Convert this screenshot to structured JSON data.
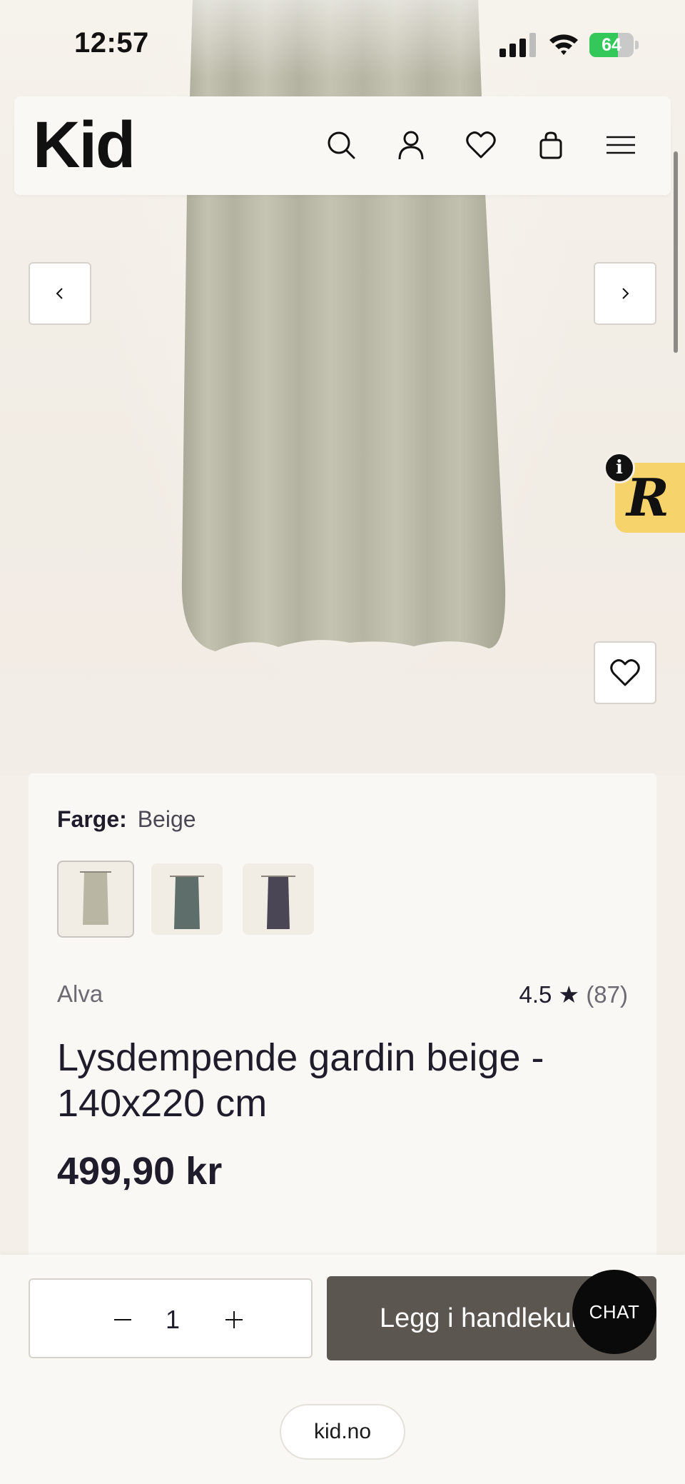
{
  "status_bar": {
    "time": "12:57",
    "battery_level": "64",
    "battery_color": "#34c759"
  },
  "header": {
    "logo": "Kid",
    "icons": [
      "search-icon",
      "account-icon",
      "wishlist-icon",
      "cart-icon",
      "menu-icon"
    ]
  },
  "gallery": {
    "prev_icon": "chevron-left-icon",
    "next_icon": "chevron-right-icon",
    "favorite_icon": "heart-icon",
    "product_image": "beige curtain",
    "badge_letter": "R",
    "badge_info": "i",
    "badge_color": "#f7d36b"
  },
  "product": {
    "color_label": "Farge:",
    "color_value": "Beige",
    "swatches": [
      {
        "name": "Beige",
        "color": "#b9b6a3"
      },
      {
        "name": "Grønn",
        "color": "#5d6e6b"
      },
      {
        "name": "Lilla",
        "color": "#4a4656"
      }
    ],
    "brand": "Alva",
    "rating": "4.5",
    "star": "★",
    "review_count": "(87)",
    "title": "Lysdempende gardin beige - 140x220 cm",
    "price": "499,90 kr"
  },
  "purchase": {
    "quantity": "1",
    "add_to_cart_label": "Legg i handlekurv",
    "button_color": "#5c5650",
    "chat_label": "CHAT"
  },
  "browser": {
    "url": "kid.no"
  }
}
